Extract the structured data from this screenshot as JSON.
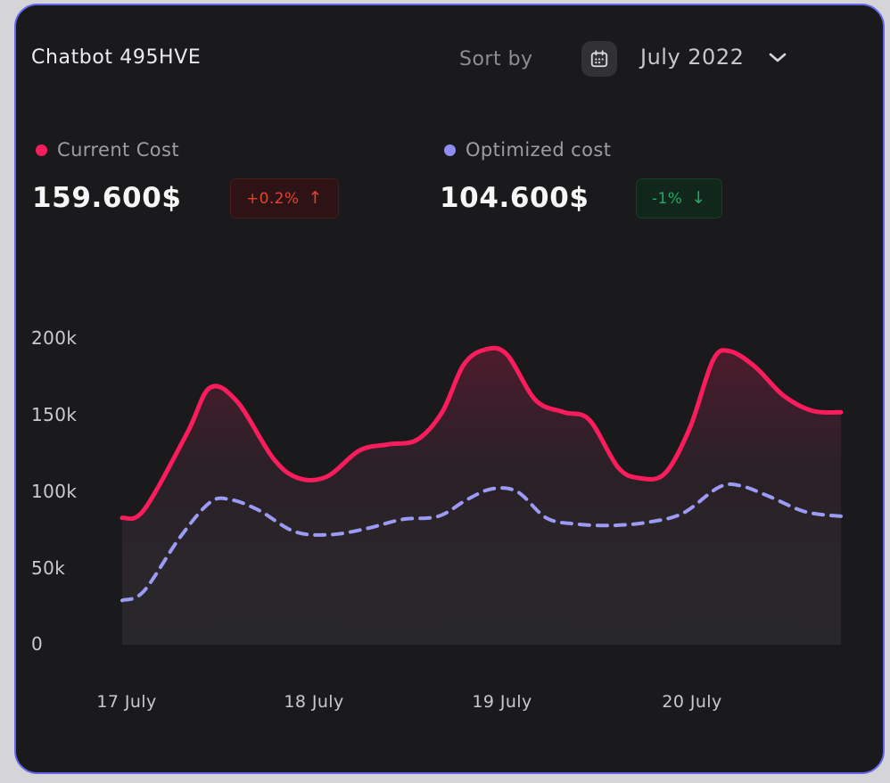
{
  "card": {
    "title": "Chatbot 495HVE"
  },
  "toolbar": {
    "sort_by_label": "Sort by",
    "period_value": "July 2022"
  },
  "stats": {
    "current": {
      "label": "Current Cost",
      "value": "159.600$",
      "badge_text": "+0.2%",
      "badge_arrow": "↑",
      "dot_color": "#fb1c5d"
    },
    "optimized": {
      "label": "Optimized cost",
      "value": "104.600$",
      "badge_text": "-1%",
      "badge_arrow": "↓",
      "dot_color": "#8f8ef6"
    }
  },
  "chart_data": {
    "type": "area",
    "title": "",
    "xlabel": "",
    "ylabel": "",
    "grid": false,
    "legend_position": "top",
    "ylim_k": [
      0,
      200
    ],
    "y_tick_labels": [
      "200k",
      "150k",
      "100k",
      "50k",
      "0"
    ],
    "x_tick_labels": [
      "17 July",
      "18 July",
      "19 July",
      "20 July"
    ],
    "x_tick_t": [
      0.006,
      0.267,
      0.529,
      0.793
    ],
    "series": [
      {
        "id": "current",
        "name": "Current Cost",
        "color": "#fb1c5d",
        "style": "solid",
        "x": [
          0,
          0.03,
          0.09,
          0.122,
          0.16,
          0.21,
          0.245,
          0.285,
          0.33,
          0.37,
          0.41,
          0.445,
          0.475,
          0.505,
          0.535,
          0.575,
          0.615,
          0.65,
          0.69,
          0.72,
          0.755,
          0.79,
          0.822,
          0.845,
          0.88,
          0.92,
          0.96,
          1
        ],
        "values_k": [
          83,
          88,
          138,
          168,
          159,
          122,
          109,
          110,
          127,
          131,
          134,
          152,
          183,
          193,
          190,
          160,
          152,
          147,
          116,
          109,
          112,
          142,
          186,
          192,
          182,
          163,
          153,
          152
        ]
      },
      {
        "id": "optimized",
        "name": "Optimized cost",
        "color": "#9b9af5",
        "style": "dashed",
        "x": [
          0,
          0.03,
          0.08,
          0.122,
          0.15,
          0.19,
          0.24,
          0.29,
          0.34,
          0.39,
          0.44,
          0.48,
          0.515,
          0.55,
          0.59,
          0.63,
          0.68,
          0.73,
          0.78,
          0.83,
          0.86,
          0.9,
          0.95,
          1
        ],
        "values_k": [
          29,
          35,
          70,
          93,
          95,
          88,
          74,
          72,
          76,
          82,
          84,
          95,
          102,
          100,
          83,
          79,
          78,
          80,
          86,
          103,
          104,
          97,
          87,
          84
        ]
      }
    ]
  }
}
